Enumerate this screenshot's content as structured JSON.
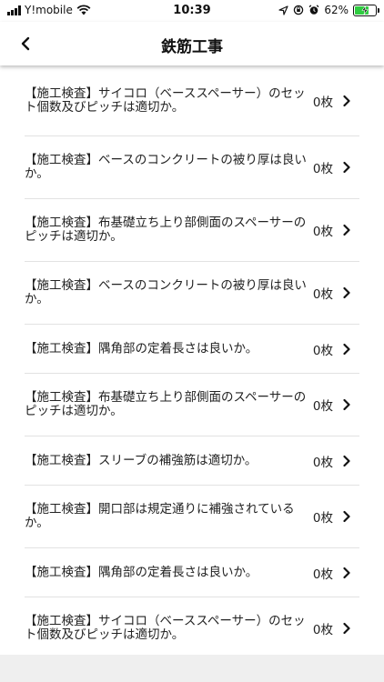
{
  "status": {
    "carrier": "Y!mobile",
    "time": "10:39",
    "battery": "62%",
    "battery_level": 0.62
  },
  "header": {
    "title": "鉄筋工事",
    "back_icon": "chevron-left-icon"
  },
  "items": [
    {
      "label": "【施工検査】サイコロ（ベーススペーサー）のセット個数及びピッチは適切か。",
      "count": "0枚"
    },
    {
      "label": "【施工検査】ベースのコンクリートの被り厚は良いか。",
      "count": "0枚"
    },
    {
      "label": "【施工検査】布基礎立ち上り部側面のスペーサーのピッチは適切か。",
      "count": "0枚"
    },
    {
      "label": "【施工検査】ベースのコンクリートの被り厚は良いか。",
      "count": "0枚"
    },
    {
      "label": "【施工検査】隅角部の定着長さは良いか。",
      "count": "0枚"
    },
    {
      "label": "【施工検査】布基礎立ち上り部側面のスペーサーのピッチは適切か。",
      "count": "0枚"
    },
    {
      "label": "【施工検査】スリーブの補強筋は適切か。",
      "count": "0枚"
    },
    {
      "label": "【施工検査】開口部は規定通りに補強されているか。",
      "count": "0枚"
    },
    {
      "label": "【施工検査】隅角部の定着長さは良いか。",
      "count": "0枚"
    },
    {
      "label": "【施工検査】サイコロ（ベーススペーサー）のセット個数及びピッチは適切か。",
      "count": "0枚"
    }
  ]
}
